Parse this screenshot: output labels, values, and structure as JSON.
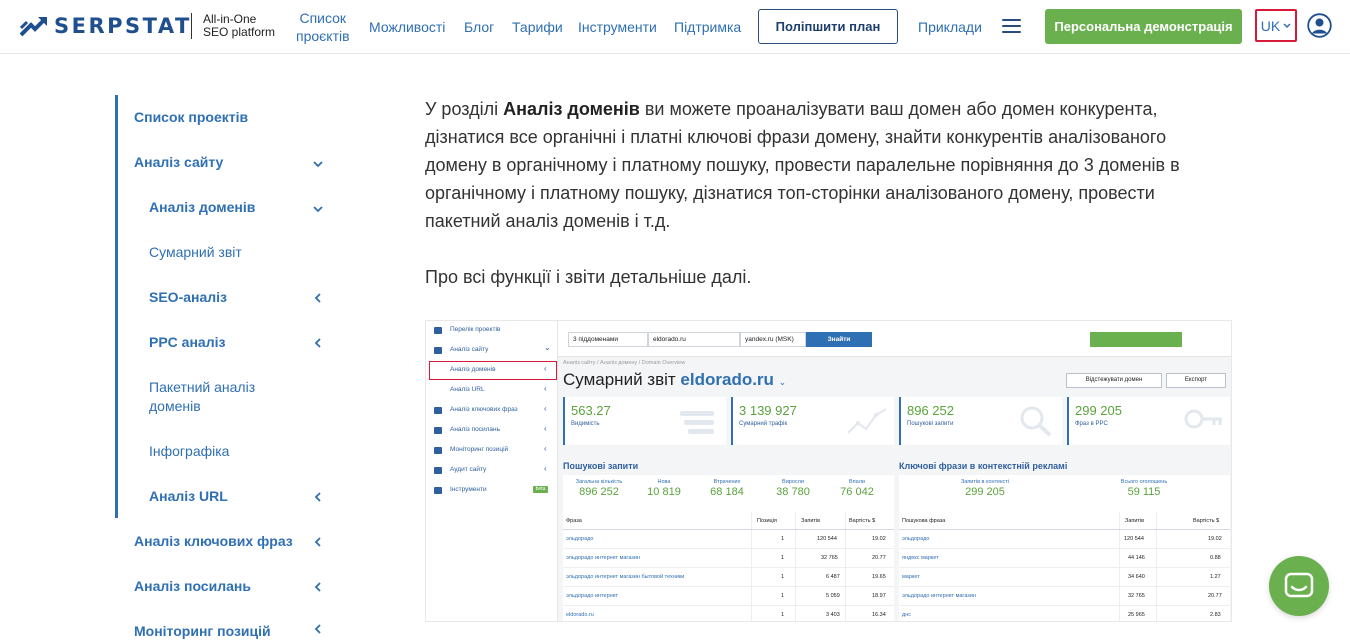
{
  "header": {
    "logo_text": "SERPSTAT",
    "tagline_1": "All-in-One",
    "tagline_2": "SEO platform",
    "nav": {
      "projects_1": "Список",
      "projects_2": "проєктів",
      "features": "Можливості",
      "blog": "Блог",
      "pricing": "Тарифи",
      "tools": "Інструменти",
      "support": "Підтримка",
      "examples": "Приклади"
    },
    "upgrade_label": "Поліпшити план",
    "demo_label": "Персональна демонстрація",
    "lang_label": "UK",
    "brand_color": "#1f4f8f",
    "accent_color": "#6bb04f",
    "highlight_color": "#d7193a"
  },
  "sidebar": {
    "items": [
      {
        "label": "Список проектів"
      },
      {
        "label": "Аналіз сайту"
      },
      {
        "label": "Аналіз доменів"
      },
      {
        "label": "Сумарний звіт"
      },
      {
        "label": "SEO-аналіз"
      },
      {
        "label": "PPC аналіз"
      },
      {
        "label": "Пакетний аналіз"
      },
      {
        "label": "доменів"
      },
      {
        "label": "Інфографіка"
      },
      {
        "label": "Аналіз URL"
      },
      {
        "label": "Аналіз ключових фраз"
      },
      {
        "label": "Аналіз посилань"
      },
      {
        "label": "Моніторинг позицій"
      }
    ]
  },
  "content": {
    "p1_pre": "У розділі ",
    "p1_bold": "Аналіз доменів",
    "p1_line1_rest": " ви можете проаналізувати ваш домен або домен конкурента,",
    "p1_line2": "дізнатися все органічні і платні ключові фрази домену, знайти конкурентів аналізованого",
    "p1_line3": "домену в органічному і платному пошуку, провести паралельне порівняння до 3 доменів в",
    "p1_line4": "органічному і платному пошуку, дізнатися топ-сторінки аналізованого домену, провести",
    "p1_line5": "пакетний аналіз доменів і т.д.",
    "p2": "Про всі функції і звіти детальніше далі."
  },
  "screenshot": {
    "left_menu": [
      "Перелік проектів",
      "Аналіз сайту",
      "Аналіз доменів",
      "Аналіз URL",
      "Аналіз ключових фраз",
      "Аналіз посилань",
      "Моніторинг позицій",
      "Аудит сайту",
      "Інструменти"
    ],
    "beta_label": "beta",
    "search_scope": "3 піддоменами",
    "search_domain": "eldorado.ru",
    "search_engine": "yandex.ru (MSK)",
    "search_button": "Знайти",
    "breadcrumb": "Аналіз сайту / Аналіз домену / Domain Overview",
    "title": "Сумарний звіт",
    "title_domain": "eldorado.ru",
    "track_button": "Відстежувати домен",
    "export_button": "Експорт",
    "cards": [
      {
        "value": "563.27",
        "label": "Видимість"
      },
      {
        "value": "3 139 927",
        "label": "Сумарний трафік"
      },
      {
        "value": "896 252",
        "label": "Пошукові запити"
      },
      {
        "value": "299 205",
        "label": "Фраз в PPC"
      }
    ],
    "organic_title": "Пошукові запити",
    "ppc_title": "Ключові фрази в контекстній рекламі",
    "organic_stats": [
      {
        "label": "Загальна кількість",
        "value": "896 252"
      },
      {
        "label": "Нова",
        "value": "10 819"
      },
      {
        "label": "Втрачених",
        "value": "68 184"
      },
      {
        "label": "Виросли",
        "value": "38 780"
      },
      {
        "label": "Впали",
        "value": "76 042"
      }
    ],
    "ppc_stats": [
      {
        "label": "Запитів в контексті",
        "value": "299 205"
      },
      {
        "label": "Всього оголошень",
        "value": "59 115"
      }
    ],
    "organic_headers": [
      "Фраза",
      "Позиція",
      "Запитів",
      "Вартість $"
    ],
    "organic_rows": [
      [
        "эльдорадо",
        "1",
        "120 544",
        "19.02"
      ],
      [
        "эльдорадо интернет магазин",
        "1",
        "32 765",
        "20.77"
      ],
      [
        "эльдорадо интернет магазин бытовой техники",
        "1",
        "6 487",
        "19.65"
      ],
      [
        "эльдорадо интернет",
        "1",
        "5 059",
        "18.97"
      ],
      [
        "eldorado.ru",
        "1",
        "3 403",
        "16.34"
      ]
    ],
    "ppc_headers": [
      "Пошукова фраза",
      "Запитів",
      "Вартість $"
    ],
    "ppc_rows": [
      [
        "эльдорадо",
        "120 544",
        "19.02"
      ],
      [
        "яндекс маркет",
        "44 146",
        "0.88"
      ],
      [
        "маркет",
        "34 640",
        "1.27"
      ],
      [
        "эльдорадо интернет магазин",
        "32 765",
        "20.77"
      ],
      [
        "днс",
        "25 965",
        "2.83"
      ]
    ]
  }
}
